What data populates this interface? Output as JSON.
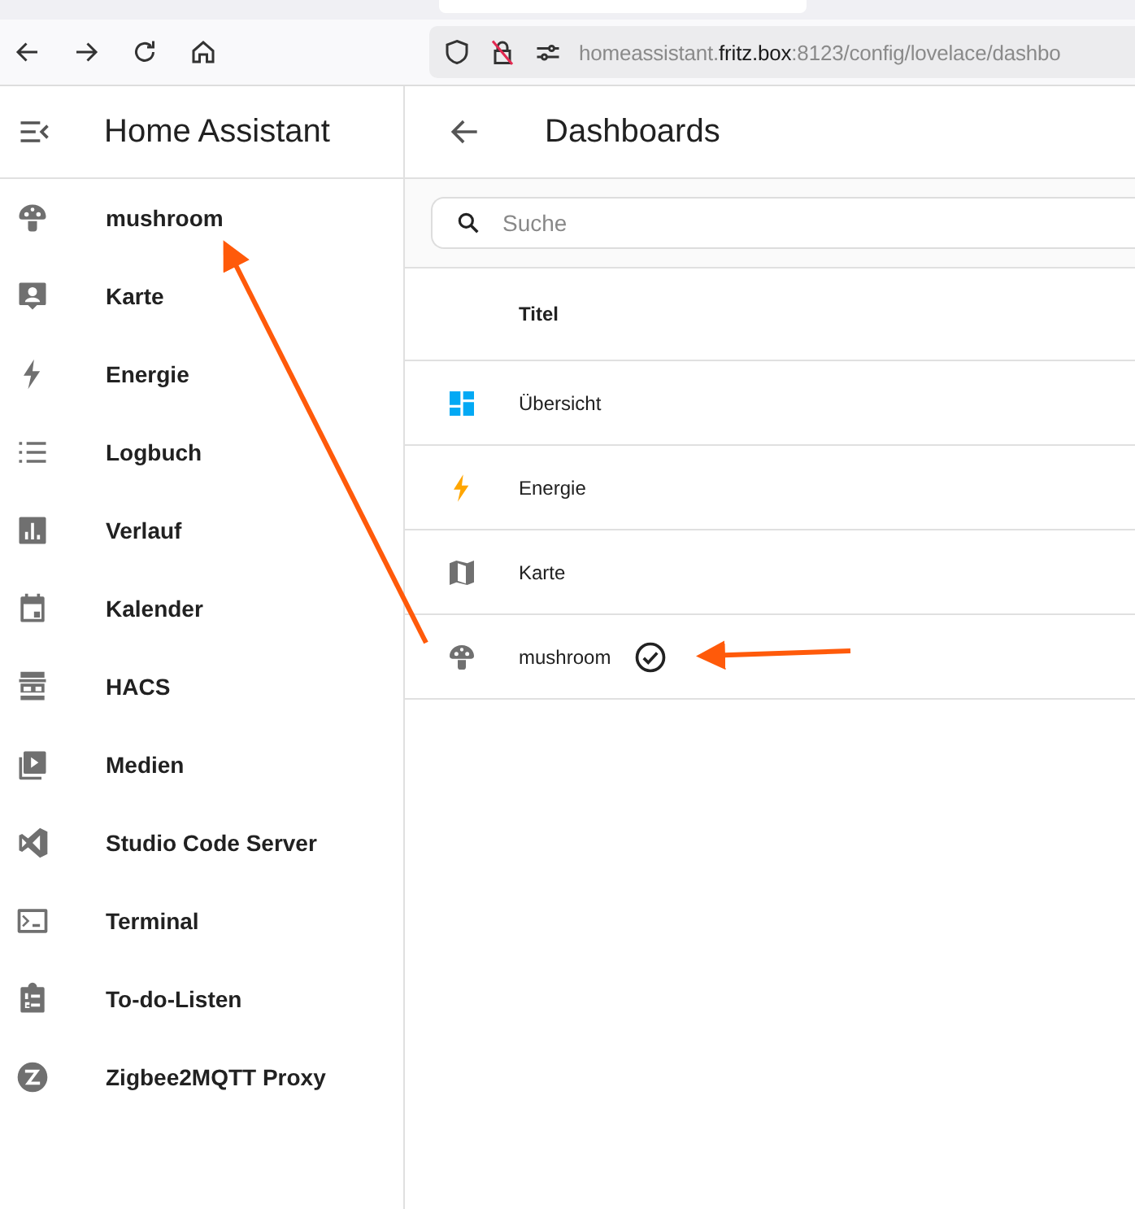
{
  "browser": {
    "url": {
      "prefix": "homeassistant.",
      "domain": "fritz.box",
      "suffix": ":8123/config/lovelace/dashbo"
    }
  },
  "sidebar": {
    "title": "Home Assistant",
    "items": [
      {
        "label": "mushroom",
        "kind": "mushroom"
      },
      {
        "label": "Karte",
        "kind": "person"
      },
      {
        "label": "Energie",
        "kind": "bolt"
      },
      {
        "label": "Logbuch",
        "kind": "list"
      },
      {
        "label": "Verlauf",
        "kind": "chart"
      },
      {
        "label": "Kalender",
        "kind": "calendar"
      },
      {
        "label": "HACS",
        "kind": "hacs"
      },
      {
        "label": "Medien",
        "kind": "media"
      },
      {
        "label": "Studio Code Server",
        "kind": "code"
      },
      {
        "label": "Terminal",
        "kind": "terminal"
      },
      {
        "label": "To-do-Listen",
        "kind": "todo"
      },
      {
        "label": "Zigbee2MQTT Proxy",
        "kind": "zigbee"
      }
    ]
  },
  "page": {
    "title": "Dashboards",
    "search": {
      "placeholder": "Suche"
    },
    "table": {
      "columns": [
        "Titel"
      ],
      "rows": [
        {
          "title": "Übersicht",
          "kind": "dashboard",
          "color": "#03a9f4",
          "default": false
        },
        {
          "title": "Energie",
          "kind": "bolt",
          "color": "#ffa600",
          "default": false
        },
        {
          "title": "Karte",
          "kind": "map",
          "color": "#707070",
          "default": false
        },
        {
          "title": "mushroom",
          "kind": "mushroom",
          "color": "#707070",
          "default": true
        }
      ]
    }
  }
}
